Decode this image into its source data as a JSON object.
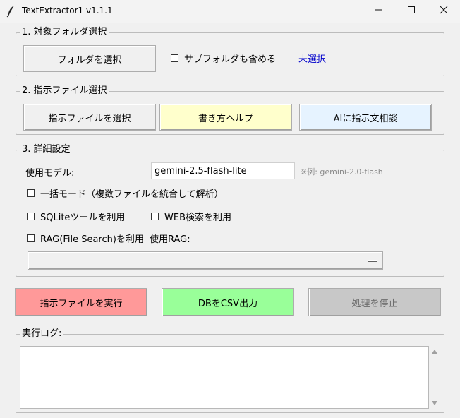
{
  "window": {
    "title": "TextExtractor1 v1.1.1"
  },
  "folder_section": {
    "label": "1. 対象フォルダ選択",
    "select_button": "フォルダを選択",
    "subfolder_checkbox": "サブフォルダも含める",
    "subfolder_checked": false,
    "status": "未選択"
  },
  "instruction_section": {
    "label": "2. 指示ファイル選択",
    "select_button": "指示ファイルを選択",
    "help_button": "書き方ヘルプ",
    "ai_button": "AIに指示文相談"
  },
  "detail_section": {
    "label": "3. 詳細設定",
    "model_label": "使用モデル:",
    "model_value": "gemini-2.5-flash-lite",
    "model_hint": "※例: gemini-2.0-flash",
    "batch_checkbox": "一括モード（複数ファイルを統合して解析）",
    "sqlite_checkbox": "SQLiteツールを利用",
    "web_checkbox": "WEB検索を利用",
    "rag_checkbox": "RAG(File Search)を利用",
    "rag_label": "使用RAG:",
    "rag_selected": ""
  },
  "actions": {
    "run_button": "指示ファイルを実行",
    "csv_button": "DBをCSV出力",
    "stop_button": "処理を停止"
  },
  "log_section": {
    "label": "実行ログ:",
    "content": ""
  },
  "colors": {
    "run_bg": "#ff9999",
    "csv_bg": "#99ff99",
    "stop_bg": "#c8c8c8",
    "help_bg": "#ffffcc",
    "ai_bg": "#e6f3ff",
    "status_text": "#0000cc"
  }
}
